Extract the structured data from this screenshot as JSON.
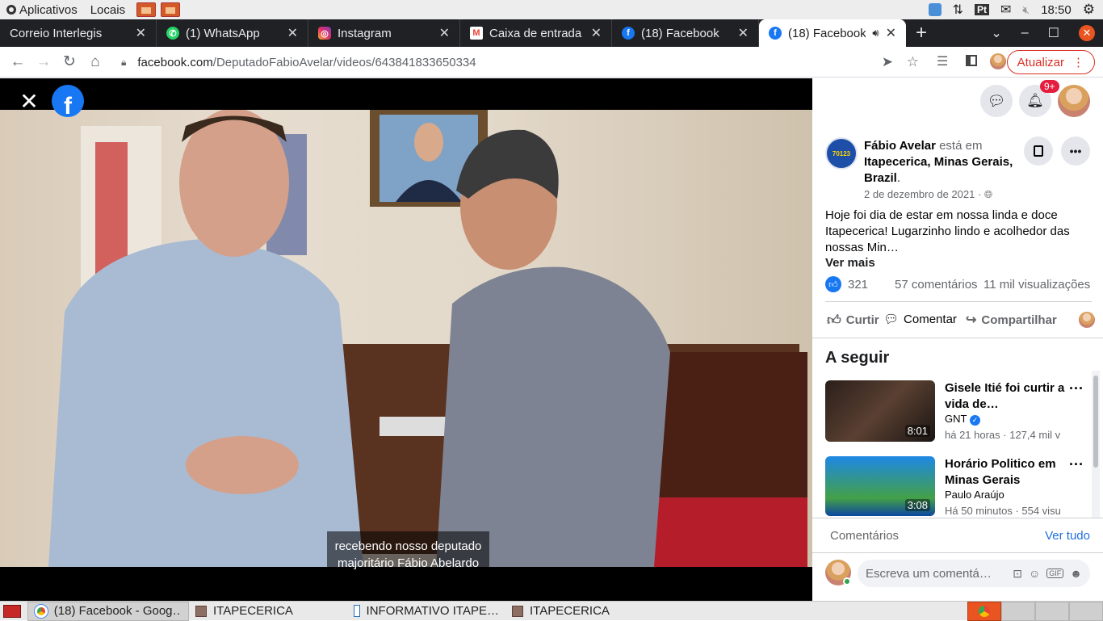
{
  "os": {
    "menu_apps": "Aplicativos",
    "menu_places": "Locais",
    "lang": "Pt",
    "time": "18:50"
  },
  "tabs": [
    {
      "title": "Correio Interlegis",
      "icon": "mail-icon"
    },
    {
      "title": "(1) WhatsApp",
      "icon": "whatsapp-icon"
    },
    {
      "title": "Instagram",
      "icon": "instagram-icon"
    },
    {
      "title": "Caixa de entrada (",
      "icon": "gmail-icon"
    },
    {
      "title": "(18) Facebook",
      "icon": "facebook-icon"
    },
    {
      "title": "(18) Facebook",
      "icon": "facebook-icon",
      "active": true
    }
  ],
  "address": {
    "domain": "facebook.com",
    "path": "/DeputadoFabioAvelar/videos/643841833650334",
    "update_label": "Atualizar"
  },
  "video": {
    "caption_line1": "recebendo nosso deputado",
    "caption_line2": "majoritário Fábio Abelardo"
  },
  "panel": {
    "notif_badge": "9+",
    "author_name": "Fábio Avelar",
    "author_status": " está em ",
    "location": "Itapecerica, Minas Gerais, Brazil",
    "location_dot": ".",
    "date": "2 de dezembro de 2021",
    "date_sep": " · ",
    "text": "Hoje foi dia de estar em nossa linda e doce Itapecerica! Lugarzinho lindo e acolhedor das nossas Min…",
    "see_more": "Ver mais",
    "likes": "321",
    "comments": "57 comentários",
    "views": "11 mil visualizações",
    "like_label": "Curtir",
    "comment_label": "Comentar",
    "share_label": "Compartilhar",
    "next_heading": "A seguir",
    "videos": [
      {
        "title": "Gisele Itié foi curtir a vida de…",
        "channel": "GNT",
        "meta": "há 21 horas · 127,4 mil vi",
        "duration": "8:01"
      },
      {
        "title": "Horário Politico em Minas Gerais",
        "channel": "Paulo Araújo",
        "meta": "Há 50 minutos · 554 visu",
        "duration": "3:08"
      }
    ],
    "comments_label": "Comentários",
    "see_all": "Ver tudo",
    "comment_placeholder": "Escreva um comentá…"
  },
  "taskbar": [
    {
      "label": "(18) Facebook - Goog…",
      "active": true
    },
    {
      "label": "ITAPECERICA"
    },
    {
      "label": "INFORMATIVO ITAPE…"
    },
    {
      "label": "ITAPECERICA"
    }
  ],
  "colors": {
    "facebook_blue": "#1877f2",
    "tab_bg": "#202124",
    "update_red": "#d93025",
    "badge_red": "#e41e3f"
  }
}
